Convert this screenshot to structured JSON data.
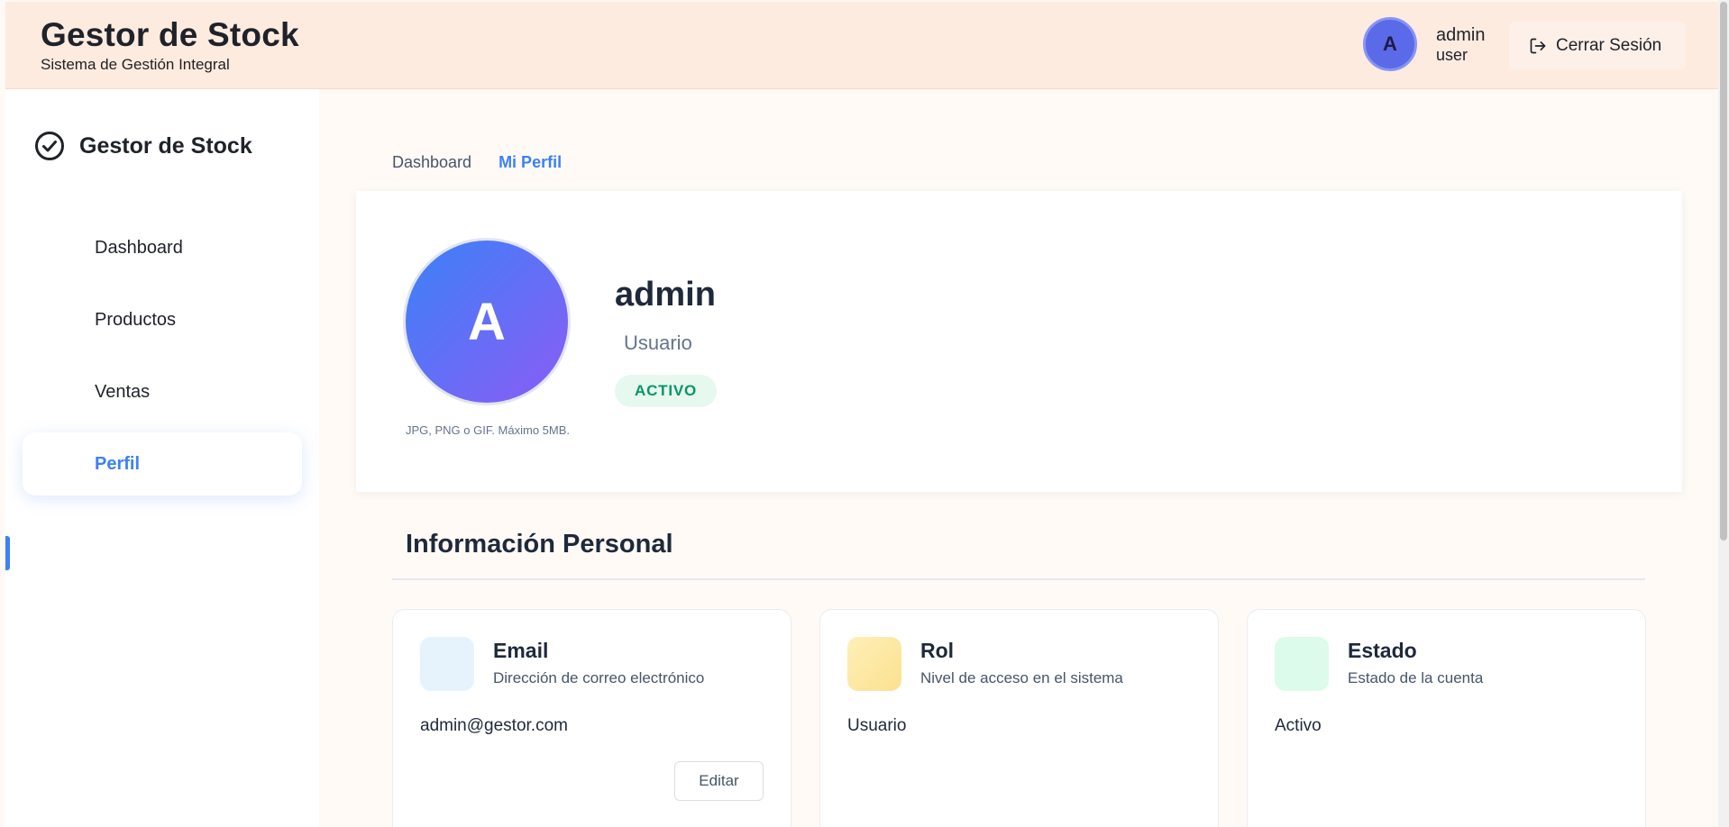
{
  "header": {
    "title": "Gestor de Stock",
    "subtitle": "Sistema de Gestión Integral",
    "avatar_initial": "A",
    "username": "admin",
    "role": "user",
    "logout_label": "Cerrar Sesión"
  },
  "sidebar": {
    "brand": "Gestor de Stock",
    "items": [
      {
        "label": "Dashboard",
        "active": false
      },
      {
        "label": "Productos",
        "active": false
      },
      {
        "label": "Ventas",
        "active": false
      },
      {
        "label": "Perfil",
        "active": true
      }
    ]
  },
  "breadcrumb": [
    "Dashboard",
    "Mi Perfil"
  ],
  "profile": {
    "avatar_initial": "A",
    "avatar_hint": "JPG, PNG o GIF. Máximo 5MB.",
    "name": "admin",
    "role": "Usuario",
    "status": "ACTIVO"
  },
  "personal_info": {
    "title": "Información Personal",
    "cards": [
      {
        "title": "Email",
        "description": "Dirección de correo electrónico",
        "value": "admin@gestor.com",
        "action": "Editar",
        "icon_color": "#e6f3fd"
      },
      {
        "title": "Rol",
        "description": "Nivel de acceso en el sistema",
        "value": "Usuario",
        "icon_color": "#fde9a8"
      },
      {
        "title": "Estado",
        "description": "Estado de la cuenta",
        "value": "Activo",
        "icon_color": "#dcfbea"
      }
    ]
  },
  "colors": {
    "accent": "#3b82f6",
    "header_bg": "#feebe0",
    "status_green": "#059669"
  },
  "icons": {
    "logout": "logout-icon",
    "brand": "check-circle-icon"
  }
}
